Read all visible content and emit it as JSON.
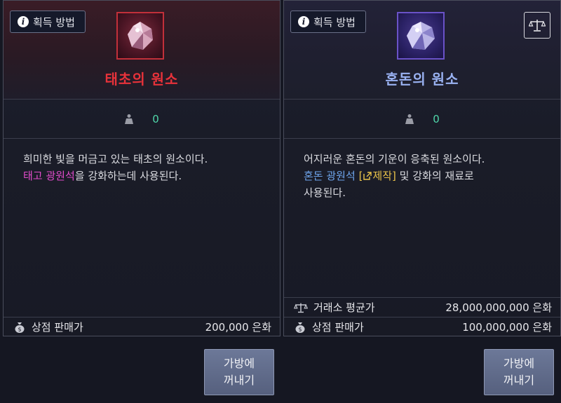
{
  "left": {
    "acquire_label": "획득 방법",
    "title": "태초의 원소",
    "title_color": "#e8323a",
    "count": "0",
    "desc_line1": "희미한 빛을 머금고 있는 태초의 원소이다.",
    "desc_line2_highlight": "태고 광원석",
    "desc_line2_rest": "을 강화하는데 사용된다.",
    "shop_label": "상점 판매가",
    "shop_price": "200,000 은화",
    "button_label": "가방에\n꺼내기"
  },
  "right": {
    "acquire_label": "획득 방법",
    "title": "혼돈의 원소",
    "title_color": "#9ab2f2",
    "count": "0",
    "desc_line1": "어지러운 혼돈의 기운이 응축된 원소이다.",
    "desc_line2_highlight": "혼돈 광원석",
    "desc_craft_open": "[",
    "desc_craft_label": "제작",
    "desc_craft_close": "]",
    "desc_line2_rest": " 및 강화의 재료로",
    "desc_line3": "사용된다.",
    "market_label": "거래소 평균가",
    "market_price": "28,000,000,000 은화",
    "shop_label": "상점 판매가",
    "shop_price": "100,000,000 은화",
    "button_label": "가방에\n꺼내기"
  },
  "icons": [
    "info-icon",
    "gem-icon",
    "scale-icon",
    "weight-icon",
    "money-bag-icon",
    "external-link-icon"
  ]
}
